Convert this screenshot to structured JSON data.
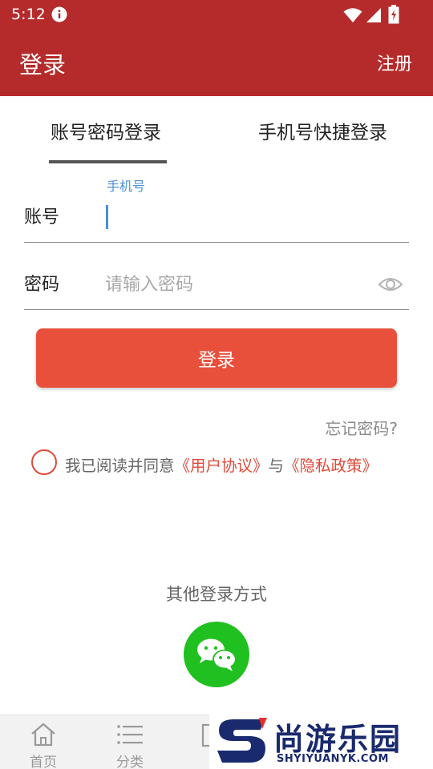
{
  "status_bar": {
    "time": "5:12"
  },
  "app_bar": {
    "title": "登录",
    "register_label": "注册"
  },
  "tabs": [
    {
      "label": "账号密码登录",
      "active": true
    },
    {
      "label": "手机号快捷登录",
      "active": false
    }
  ],
  "account": {
    "label": "账号",
    "floating_hint": "手机号",
    "value": ""
  },
  "password": {
    "label": "密码",
    "placeholder": "请输入密码"
  },
  "login_button": "登录",
  "forgot_password": "忘记密码?",
  "agreement": {
    "prefix": "我已阅读并同意",
    "user_agreement": "《用户协议》",
    "conjunction": "与",
    "privacy_policy": "《隐私政策》"
  },
  "other_login": {
    "title": "其他登录方式",
    "icon": "wechat-icon"
  },
  "bottom_nav": [
    {
      "label": "首页",
      "icon": "home-icon"
    },
    {
      "label": "分类",
      "icon": "menu-icon"
    },
    {
      "label": "",
      "icon": "partial-icon"
    }
  ],
  "watermark": {
    "text": "尚游乐园",
    "subtext": "SHYIYUANYK.COM"
  },
  "colors": {
    "brand_red": "#b52b2b",
    "button_red": "#e8503c",
    "link_red": "#e04a3a",
    "focus_blue": "#4a90d9",
    "wechat_green": "#20c020"
  }
}
